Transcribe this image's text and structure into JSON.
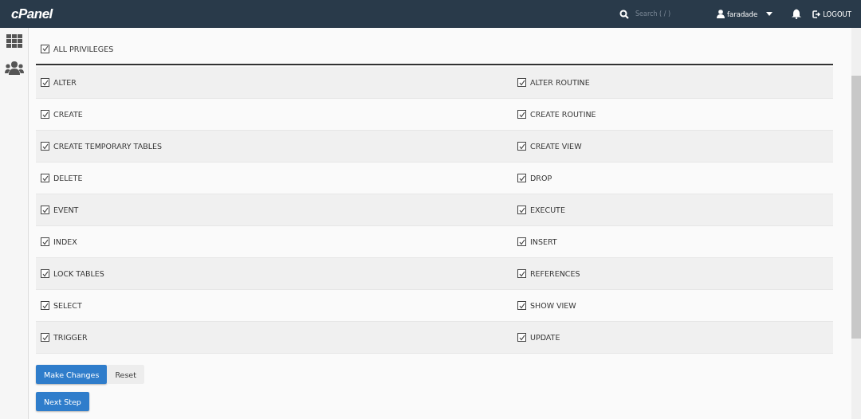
{
  "header": {
    "logo": "cPanel",
    "search": {
      "placeholder": "Search ( / )"
    },
    "user": "faradade",
    "logout": "LOGOUT"
  },
  "all_privileges": {
    "label": "ALL PRIVILEGES",
    "checked": true
  },
  "privileges": [
    [
      {
        "label": "ALTER",
        "checked": true
      },
      {
        "label": "ALTER ROUTINE",
        "checked": true
      }
    ],
    [
      {
        "label": "CREATE",
        "checked": true
      },
      {
        "label": "CREATE ROUTINE",
        "checked": true
      }
    ],
    [
      {
        "label": "CREATE TEMPORARY TABLES",
        "checked": true
      },
      {
        "label": "CREATE VIEW",
        "checked": true
      }
    ],
    [
      {
        "label": "DELETE",
        "checked": true
      },
      {
        "label": "DROP",
        "checked": true
      }
    ],
    [
      {
        "label": "EVENT",
        "checked": true
      },
      {
        "label": "EXECUTE",
        "checked": true
      }
    ],
    [
      {
        "label": "INDEX",
        "checked": true
      },
      {
        "label": "INSERT",
        "checked": true
      }
    ],
    [
      {
        "label": "LOCK TABLES",
        "checked": true
      },
      {
        "label": "REFERENCES",
        "checked": true
      }
    ],
    [
      {
        "label": "SELECT",
        "checked": true
      },
      {
        "label": "SHOW VIEW",
        "checked": true
      }
    ],
    [
      {
        "label": "TRIGGER",
        "checked": true
      },
      {
        "label": "UPDATE",
        "checked": true
      }
    ]
  ],
  "buttons": [
    {
      "label": "Make Changes",
      "kind": "primary"
    },
    {
      "label": "Reset",
      "kind": "plain"
    }
  ],
  "next_button": {
    "label": "Next Step"
  }
}
